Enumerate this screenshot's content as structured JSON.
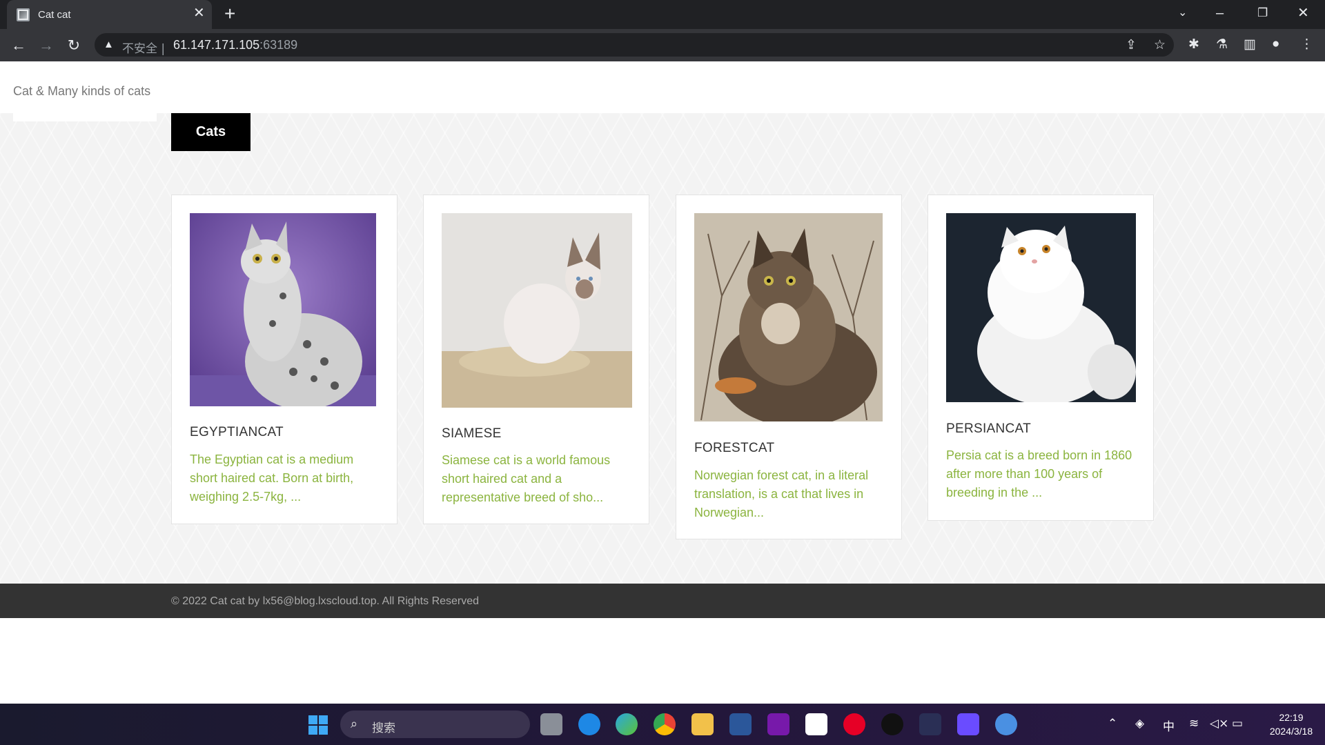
{
  "browser": {
    "tab_title": "Cat cat",
    "tab_close": "✕",
    "new_tab": "+",
    "insecure_label": "不安全 |",
    "url_host": "61.147.171.105",
    "url_port": ":63189"
  },
  "site": {
    "brand": "Cat & Many kinds of cats",
    "nav_button": "Cats",
    "cards": [
      {
        "title": "EGYPTIANCAT",
        "description": "The Egyptian cat is a medium short haired cat. Born at birth, weighing 2.5-7kg, ..."
      },
      {
        "title": "SIAMESE",
        "description": "Siamese cat is a world famous short haired cat and a representative breed of sho..."
      },
      {
        "title": "FORESTCAT",
        "description": "Norwegian forest cat, in a literal translation, is a cat that lives in Norwegian..."
      },
      {
        "title": "PERSIANCAT",
        "description": "Persia cat is a breed born in 1860 after more than 100 years of breeding in the ..."
      }
    ],
    "footer": "© 2022 Cat cat by lx56@blog.lxscloud.top. All Rights Reserved"
  },
  "taskbar": {
    "search_placeholder": "搜索",
    "ime": "中",
    "time": "22:19",
    "date": "2024/3/18"
  },
  "colors": {
    "accent_green": "#8bb43f",
    "chrome_dark": "#202124",
    "chrome_toolbar": "#35363a"
  }
}
